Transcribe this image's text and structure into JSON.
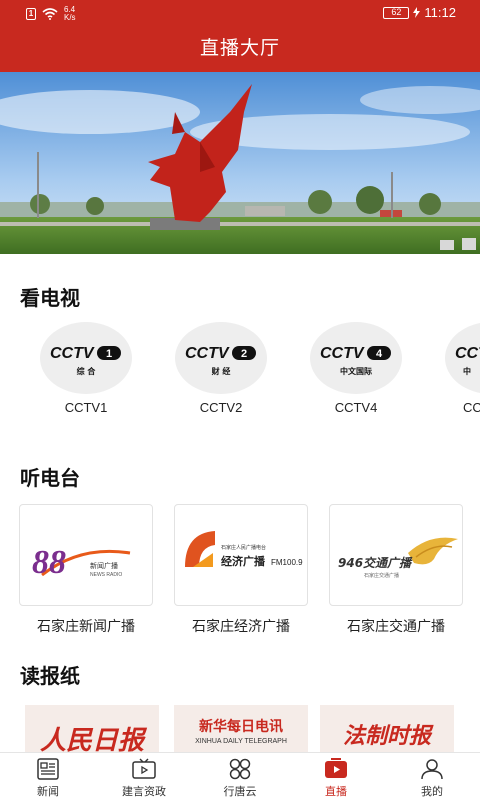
{
  "status_bar": {
    "sim_label": "1",
    "net_speed_value": "6.4",
    "net_speed_unit": "K/s",
    "battery": "62",
    "time": "11:12"
  },
  "header": {
    "title": "直播大厅"
  },
  "sections": {
    "tv_title": "看电视",
    "radio_title": "听电台",
    "paper_title": "读报纸"
  },
  "tv_channels": [
    {
      "label": "CCTV1",
      "logo_text": "CCTV",
      "logo_num": "1",
      "logo_sub": "综 合"
    },
    {
      "label": "CCTV2",
      "logo_text": "CCTV",
      "logo_num": "2",
      "logo_sub": "财 经"
    },
    {
      "label": "CCTV4",
      "logo_text": "CCTV",
      "logo_num": "4",
      "logo_sub": "中文国际"
    },
    {
      "label": "CC",
      "logo_text": "CCTV",
      "logo_num": "",
      "logo_sub": "中"
    }
  ],
  "radio_stations": [
    {
      "label": "石家庄新闻广播",
      "logo_main": "88",
      "logo_sub": "新闻广播",
      "logo_en": "NEWS RADIO"
    },
    {
      "label": "石家庄经济广播",
      "logo_main": "经济广播",
      "logo_sub": "FM100.9",
      "logo_top": "石家庄人民广播电台"
    },
    {
      "label": "石家庄交通广播",
      "logo_main": "946交通广播",
      "logo_sub": "石家庄交通广播"
    }
  ],
  "newspapers": [
    {
      "name": "人民日报"
    },
    {
      "name": "新华每日电讯",
      "en": "XINHUA DAILY TELEGRAPH"
    },
    {
      "name": "法制时报"
    }
  ],
  "bottom_nav": [
    {
      "label": "新闻",
      "icon": "news-icon",
      "active": false
    },
    {
      "label": "建言资政",
      "icon": "tv-icon",
      "active": false
    },
    {
      "label": "行唐云",
      "icon": "grid-icon",
      "active": false
    },
    {
      "label": "直播",
      "icon": "play-icon",
      "active": true
    },
    {
      "label": "我的",
      "icon": "user-icon",
      "active": false
    }
  ],
  "colors": {
    "brand": "#c8291f",
    "cctv_red": "#c8291f"
  }
}
